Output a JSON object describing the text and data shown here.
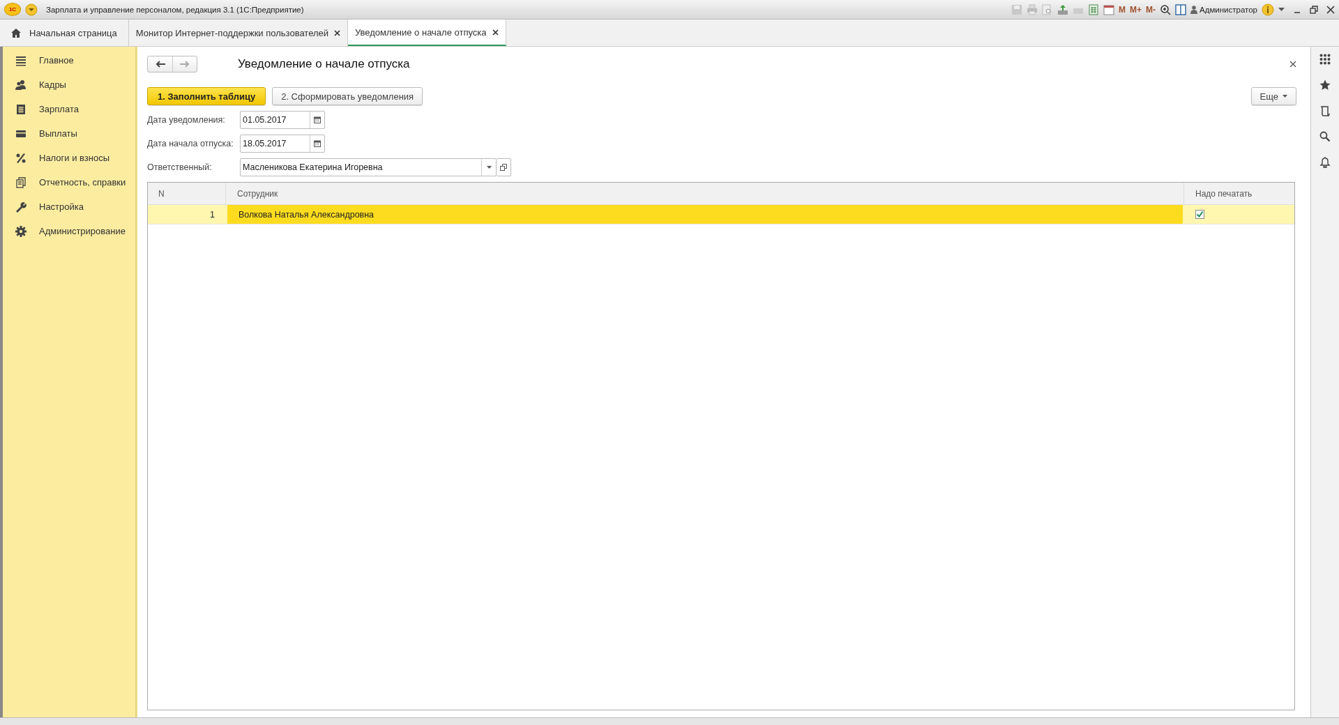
{
  "window": {
    "logo": "1С",
    "title": "Зарплата и управление персоналом, редакция 3.1  (1С:Предприятие)",
    "memory_buttons": [
      "M",
      "M+",
      "M-"
    ],
    "user": "Администратор"
  },
  "tabs": [
    {
      "label": "Начальная страница",
      "kind": "home",
      "selected": false
    },
    {
      "label": "Монитор Интернет-поддержки пользователей",
      "kind": "document",
      "selected": false
    },
    {
      "label": "Уведомление о начале отпуска",
      "kind": "document",
      "selected": true
    }
  ],
  "sidebar": {
    "items": [
      {
        "label": "Главное",
        "kind": "menu"
      },
      {
        "label": "Кадры",
        "kind": "people"
      },
      {
        "label": "Зарплата",
        "kind": "calculator"
      },
      {
        "label": "Выплаты",
        "kind": "card"
      },
      {
        "label": "Налоги и взносы",
        "kind": "percent"
      },
      {
        "label": "Отчетность, справки",
        "kind": "reports"
      },
      {
        "label": "Настройка",
        "kind": "wrench"
      },
      {
        "label": "Администрирование",
        "kind": "gear"
      }
    ]
  },
  "form": {
    "title": "Уведомление о начале отпуска",
    "nav": {
      "back_disabled": false,
      "forward_disabled": true
    },
    "buttons": [
      {
        "label": "1. Заполнить таблицу",
        "kind": "primary"
      },
      {
        "label": "2. Сформировать уведомления",
        "kind": "default"
      }
    ],
    "more_button": "Еще",
    "fields": [
      {
        "label": "Дата уведомления:",
        "value": "01.05.2017",
        "kind": "date"
      },
      {
        "label": "Дата начала отпуска:",
        "value": "18.05.2017",
        "kind": "date"
      },
      {
        "label": "Ответственный:",
        "value": "Масленикова Екатерина Игоревна",
        "kind": "reference"
      }
    ],
    "table": {
      "columns": [
        "N",
        "Сотрудник",
        "Надо печатать"
      ],
      "rows": [
        {
          "n": "1",
          "employee": "Волкова Наталья Александровна",
          "print": true,
          "selected": true
        }
      ]
    }
  }
}
